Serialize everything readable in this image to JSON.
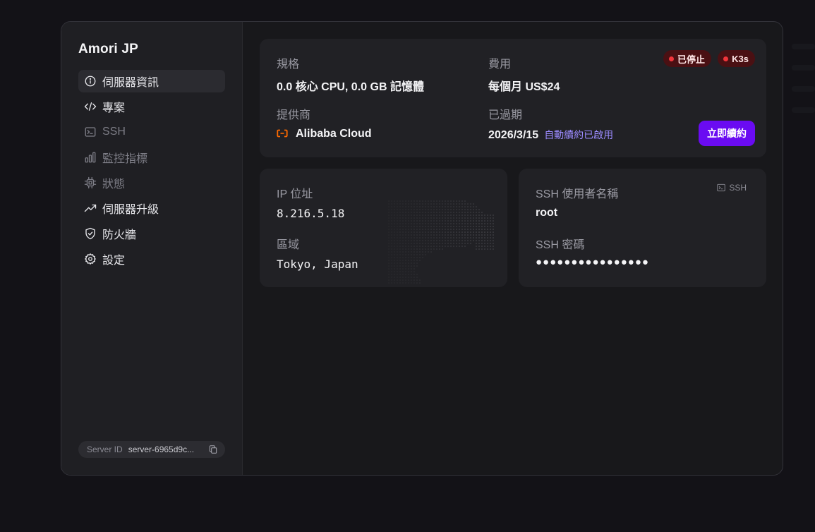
{
  "server": {
    "name": "Amori JP",
    "id_label": "Server ID",
    "id_value": "server-6965d9c..."
  },
  "sidebar": {
    "items": [
      {
        "label": "伺服器資訊",
        "icon": "info-icon",
        "active": true,
        "disabled": false
      },
      {
        "label": "專案",
        "icon": "code-icon",
        "active": false,
        "disabled": false
      },
      {
        "label": "SSH",
        "icon": "terminal-icon",
        "active": false,
        "disabled": true
      },
      {
        "label": "監控指標",
        "icon": "bar-chart-icon",
        "active": false,
        "disabled": true
      },
      {
        "label": "狀態",
        "icon": "cpu-chip-icon",
        "active": false,
        "disabled": true
      },
      {
        "label": "伺服器升級",
        "icon": "trending-up-icon",
        "active": false,
        "disabled": false
      },
      {
        "label": "防火牆",
        "icon": "shield-check-icon",
        "active": false,
        "disabled": false
      },
      {
        "label": "設定",
        "icon": "gear-icon",
        "active": false,
        "disabled": false
      }
    ]
  },
  "overview": {
    "spec_label": "規格",
    "spec_value": "0.0 核心 CPU, 0.0 GB 記憶體",
    "cost_label": "費用",
    "cost_value": "每個月 US$24",
    "provider_label": "提供商",
    "provider_value": "Alibaba Cloud",
    "provider_icon": "alibaba-cloud-icon",
    "expiry_label": "已過期",
    "expiry_date": "2026/3/15",
    "auto_renew_text": "自動續約已啟用",
    "renew_button": "立即續約",
    "badges": [
      {
        "label": "已停止",
        "color": "#f0353b"
      },
      {
        "label": "K3s",
        "color": "#f0353b"
      }
    ]
  },
  "network": {
    "ip_label": "IP 位址",
    "ip_value": "8.216.5.18",
    "region_label": "區域",
    "region_value": "Tokyo, Japan"
  },
  "ssh": {
    "chip_label": "SSH",
    "username_label": "SSH 使用者名稱",
    "username_value": "root",
    "password_label": "SSH 密碼",
    "password_value": "●●●●●●●●●●●●●●●●"
  },
  "colors": {
    "accent": "#6a0bf2",
    "link": "#9c8bff",
    "status_stopped": "#f0353b",
    "provider_orange": "#ff6a00"
  }
}
